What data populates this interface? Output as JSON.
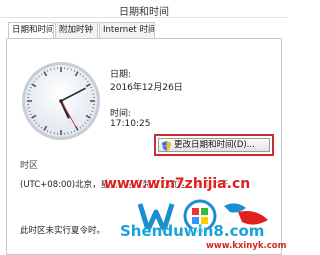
{
  "window": {
    "title": "日期和时间"
  },
  "tabs": [
    {
      "label": "日期和时间",
      "active": true
    },
    {
      "label": "附加时钟",
      "active": false
    },
    {
      "label": "Internet 时间",
      "active": false
    }
  ],
  "clock": {
    "hour": 17,
    "minute": 10,
    "second": 25
  },
  "date": {
    "label": "日期:",
    "value": "2016年12月26日"
  },
  "time": {
    "label": "时间:",
    "value": "17:10:25"
  },
  "change_button": {
    "label": "更改日期和时间(D)..."
  },
  "timezone": {
    "section_label": "时区",
    "value": "(UTC+08:00)北京，重庆，香港特别行政区，乌鲁木齐"
  },
  "sync_note": "此时区未实行夏令时。",
  "watermark": {
    "url": "www.win7zhijia.cn",
    "brand": "Shenduwin8.com",
    "site": "www.kxinyk.com"
  },
  "colors": {
    "highlight_border": "#c9302c",
    "watermark_red": "#e0201e",
    "watermark_blue": "#1aa3d6"
  }
}
